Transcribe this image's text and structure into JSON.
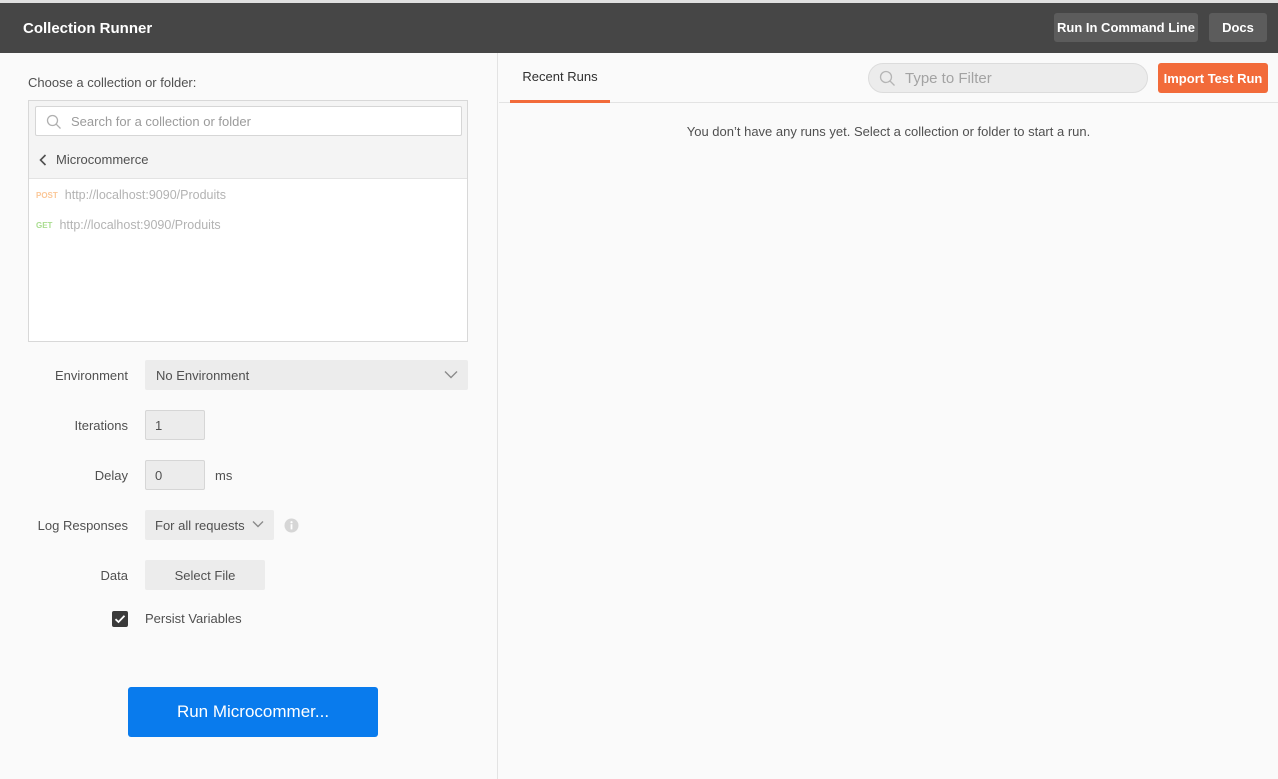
{
  "header": {
    "title": "Collection Runner",
    "run_cmdline_label": "Run In Command Line",
    "docs_label": "Docs"
  },
  "left": {
    "choose_label": "Choose a collection or folder:",
    "search_placeholder": "Search for a collection or folder",
    "breadcrumb": "Microcommerce",
    "requests": [
      {
        "method": "POST",
        "url": "http://localhost:9090/Produits"
      },
      {
        "method": "GET",
        "url": "http://localhost:9090/Produits"
      }
    ],
    "environment": {
      "label": "Environment",
      "value": "No Environment"
    },
    "iterations": {
      "label": "Iterations",
      "value": "1"
    },
    "delay": {
      "label": "Delay",
      "value": "0",
      "unit": "ms"
    },
    "log_responses": {
      "label": "Log Responses",
      "value": "For all requests"
    },
    "data": {
      "label": "Data",
      "button": "Select File"
    },
    "persist": {
      "label": "Persist Variables",
      "checked": true
    },
    "run_button": "Run Microcommer..."
  },
  "right": {
    "tab_label": "Recent Runs",
    "filter_placeholder": "Type to Filter",
    "import_label": "Import Test Run",
    "empty_message": "You don’t have any runs yet. Select a collection or folder to start a run."
  },
  "colors": {
    "accent_orange": "#f26b3a",
    "run_blue": "#097bed",
    "topbar": "#464646",
    "post_method": "#fbc797",
    "get_method": "#a9dd8f"
  }
}
